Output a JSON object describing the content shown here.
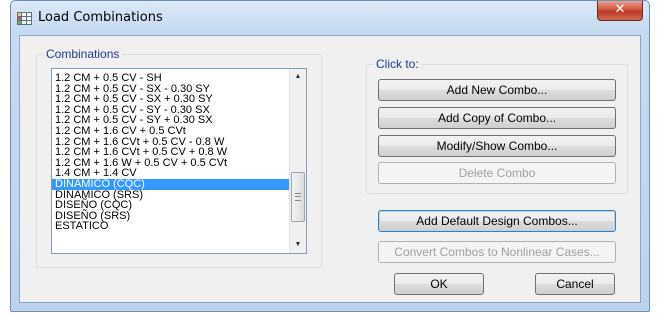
{
  "window": {
    "title": "Load Combinations",
    "close_glyph": "✕"
  },
  "combinations": {
    "label": "Combinations",
    "items": [
      "1.2 CM + 0.5 CV - SH",
      "1.2 CM + 0.5 CV - SX - 0.30 SY",
      "1.2 CM + 0.5 CV - SX + 0.30 SY",
      "1.2 CM + 0.5 CV - SY - 0.30 SX",
      "1.2 CM + 0.5 CV - SY + 0.30 SX",
      "1.2 CM + 1.6 CV + 0.5 CVt",
      "1.2 CM + 1.6 CVt + 0.5 CV - 0.8 W",
      "1.2 CM + 1.6 CVt + 0.5 CV + 0.8 W",
      "1.2 CM + 1.6 W + 0.5 CV + 0.5 CVt",
      "1.4 CM + 1.4 CV",
      "DINAMICO (CQC)",
      "DINAMICO (SRS)",
      "DISEÑO (CQC)",
      "DISEÑO (SRS)",
      "ESTATICO"
    ],
    "selected_index": 10,
    "scroll_up_glyph": "▲",
    "scroll_down_glyph": "▼"
  },
  "click_to": {
    "label": "Click to:",
    "add_new": "Add New Combo...",
    "add_copy": "Add Copy of Combo...",
    "modify_show": "Modify/Show Combo...",
    "delete": "Delete Combo"
  },
  "add_default_design": "Add Default Design Combos...",
  "convert_nonlinear": "Convert Combos to Nonlinear Cases...",
  "ok": "OK",
  "cancel": "Cancel",
  "colors": {
    "selection": "#3399ff",
    "group_label": "#1b3c8c",
    "close": "#c0392b"
  }
}
